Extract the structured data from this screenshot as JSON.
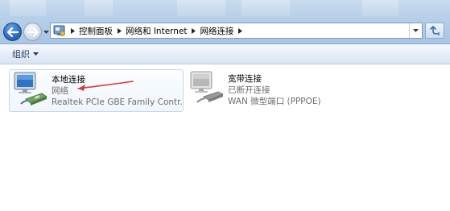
{
  "address_bar": {
    "breadcrumbs": [
      "控制面板",
      "网络和 Internet",
      "网络连接"
    ]
  },
  "command_bar": {
    "organize_label": "组织"
  },
  "connections": [
    {
      "name": "本地连接",
      "status": "网络",
      "device": "Realtek PCIe GBE Family Contr...",
      "icon": "lan-adapter-icon",
      "selected": true
    },
    {
      "name": "宽带连接",
      "status": "已断开连接",
      "device": "WAN 微型端口 (PPPOE)",
      "icon": "broadband-disconnected-icon",
      "selected": false
    }
  ],
  "colors": {
    "title_bar": "#b7cfe8",
    "command_bar": "#e6eef8",
    "annotation_arrow": "#d8393a",
    "selection_border": "#c5d7ea",
    "status_text": "#6d6d6d"
  }
}
